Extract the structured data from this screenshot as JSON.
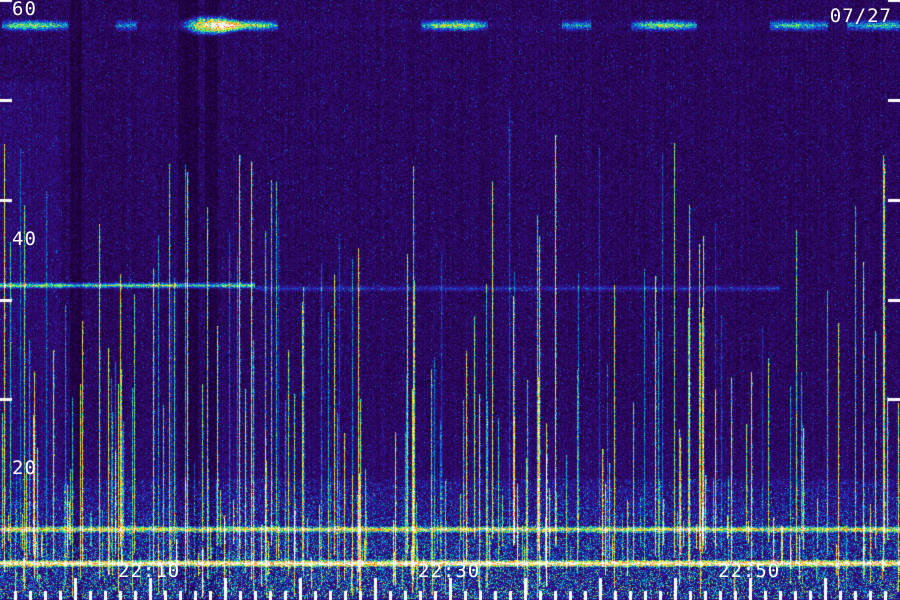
{
  "chart_data": {
    "type": "heatmap",
    "title": "",
    "date_label": "07/27",
    "xlabel": "",
    "ylabel": "",
    "x_axis": {
      "unit": "time (HH:MM)",
      "range": [
        "22:00",
        "23:00"
      ],
      "labeled_ticks": [
        "22:10",
        "22:30",
        "22:50"
      ],
      "major_tick_minutes": [
        5,
        10,
        15,
        20,
        25,
        30,
        35,
        40,
        45,
        50,
        55
      ],
      "minor_tick_minutes": [
        1,
        2,
        3,
        4,
        6,
        7,
        8,
        9,
        11,
        12,
        13,
        14,
        16,
        17,
        18,
        19,
        21,
        22,
        23,
        24,
        26,
        27,
        28,
        29,
        31,
        32,
        33,
        34,
        36,
        37,
        38,
        39,
        41,
        42,
        43,
        44,
        46,
        47,
        48,
        49,
        51,
        52,
        53,
        54,
        56,
        57,
        58,
        59
      ]
    },
    "y_axis": {
      "range": [
        0,
        60
      ],
      "labeled_ticks": [
        60,
        40,
        20
      ],
      "unlabeled_ticks": [
        50,
        30
      ]
    },
    "colormap": [
      "#000000",
      "#1a0036",
      "#320a6e",
      "#2a1fb0",
      "#0a78e0",
      "#18d8a8",
      "#b8f040",
      "#ffee20",
      "#ff5a1e",
      "#ffffff"
    ],
    "grid": false,
    "legend": "none",
    "features": [
      {
        "kind": "horizontal_band",
        "y": 57.5,
        "x_range": [
          "22:00",
          "23:00"
        ],
        "intensity": 0.55,
        "patchy": true
      },
      {
        "kind": "hotspot",
        "y": 57.5,
        "x_range": [
          "22:12",
          "22:16"
        ],
        "intensity": 0.85
      },
      {
        "kind": "horizontal_band",
        "y": 31.5,
        "x_range": [
          "22:00",
          "22:17"
        ],
        "intensity": 0.5
      },
      {
        "kind": "horizontal_band",
        "y": 31.2,
        "x_range": [
          "22:17",
          "22:52"
        ],
        "intensity": 0.18
      },
      {
        "kind": "horizontal_band",
        "y": 7.0,
        "x_range": [
          "22:00",
          "23:00"
        ],
        "intensity": 0.6
      },
      {
        "kind": "horizontal_band",
        "y": 3.6,
        "x_range": [
          "22:00",
          "23:00"
        ],
        "intensity": 0.95
      },
      {
        "kind": "low_frequency_noise",
        "y_range": [
          0,
          12
        ],
        "intensity": 0.55
      },
      {
        "kind": "vertical_streaks",
        "y_range": [
          2,
          58
        ],
        "intensity": 0.7,
        "density": "high"
      }
    ]
  }
}
